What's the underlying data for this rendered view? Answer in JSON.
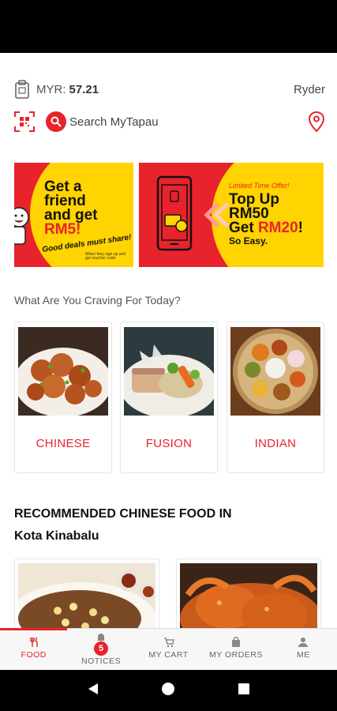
{
  "wallet": {
    "currency_label": "MYR:",
    "balance": "57.21",
    "username": "Ryder"
  },
  "search": {
    "label": "Search MyTapau"
  },
  "banners": [
    {
      "title_line1": "Get a",
      "title_line2": "friend",
      "title_line3": "and get",
      "highlight": "RM5!",
      "tagline": "Good deals must share!",
      "fine_print": "When they sign up and get voucher code"
    },
    {
      "limited": "Limited Time Offer!",
      "line1": "Top Up",
      "line2": "RM50",
      "line3_prefix": "Get ",
      "highlight": "RM20",
      "line3_suffix": "!",
      "line4": "So Easy."
    }
  ],
  "craving": {
    "heading": "What Are You Craving For Today?",
    "categories": [
      {
        "label": "CHINESE"
      },
      {
        "label": "FUSION"
      },
      {
        "label": "INDIAN"
      }
    ]
  },
  "recommended": {
    "title_line1": "RECOMMENDED CHINESE FOOD IN",
    "title_line2": "Kota Kinabalu"
  },
  "nav": {
    "items": [
      {
        "label": "FOOD",
        "icon": "cutlery-icon",
        "active": true
      },
      {
        "label": "NOTICES",
        "icon": "bell-icon",
        "badge": "5"
      },
      {
        "label": "MY CART",
        "icon": "cart-icon"
      },
      {
        "label": "MY ORDERS",
        "icon": "bag-icon"
      },
      {
        "label": "ME",
        "icon": "person-icon"
      }
    ]
  },
  "colors": {
    "accent": "#e8232c",
    "yellow": "#ffd400"
  }
}
